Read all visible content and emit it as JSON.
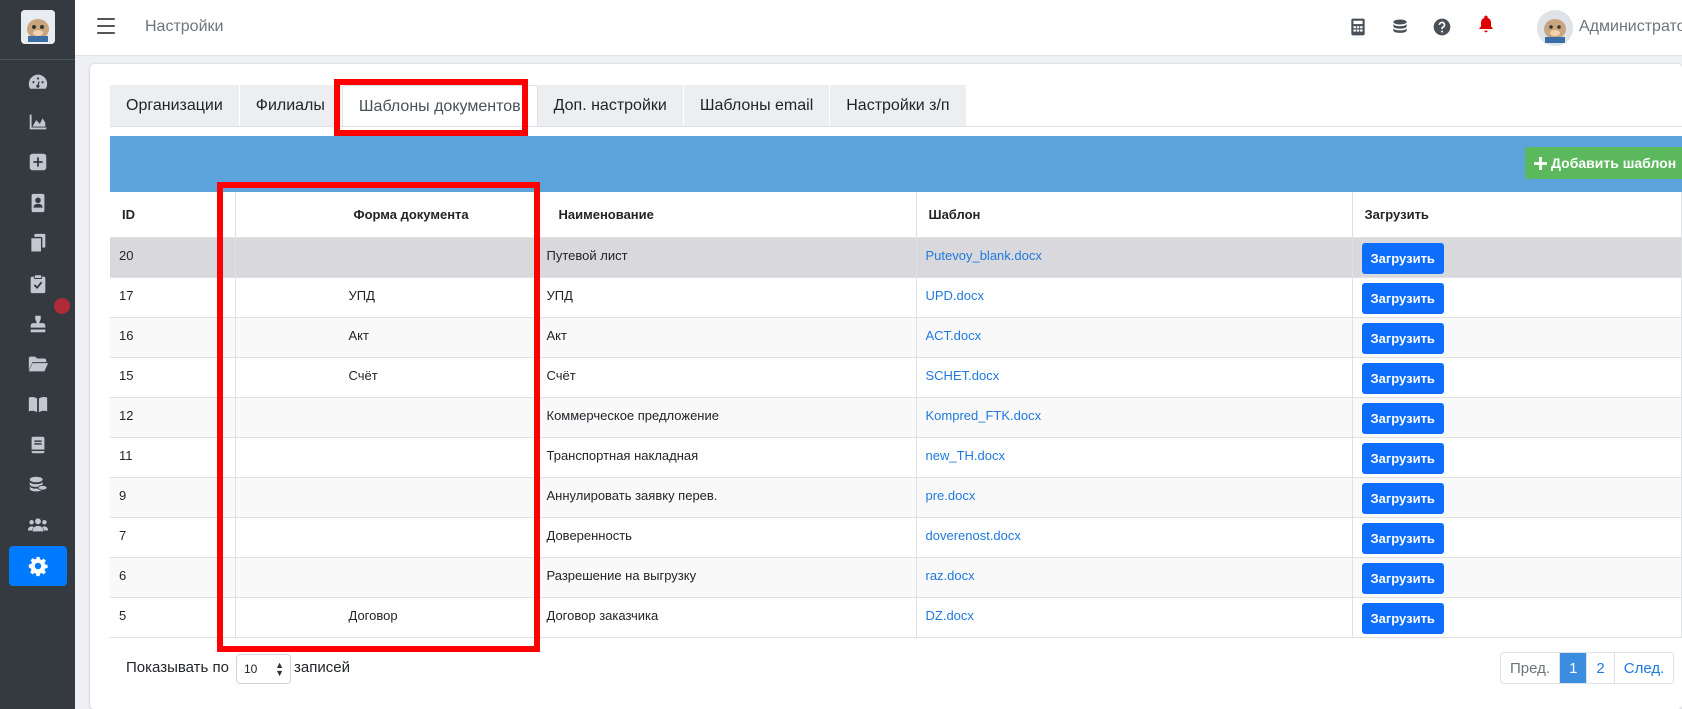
{
  "navbar": {
    "title": "Настройки",
    "user_name": "Администрато"
  },
  "sidebar": {
    "items": [
      {
        "icon": "tachometer-icon"
      },
      {
        "icon": "area-chart-icon"
      },
      {
        "icon": "plus-square-icon"
      },
      {
        "icon": "contact-card-icon"
      },
      {
        "icon": "copy-icon"
      },
      {
        "icon": "clipboard-check-icon"
      },
      {
        "icon": "stamp-icon"
      },
      {
        "icon": "folder-open-icon"
      },
      {
        "icon": "book-open-icon"
      },
      {
        "icon": "book-icon"
      },
      {
        "icon": "coins-icon"
      },
      {
        "icon": "users-icon"
      },
      {
        "icon": "gear-icon"
      }
    ],
    "active": "gear-icon"
  },
  "tabs": [
    {
      "label": "Организации"
    },
    {
      "label": "Филиалы"
    },
    {
      "label": "Шаблоны документов"
    },
    {
      "label": "Доп. настройки"
    },
    {
      "label": "Шаблоны email"
    },
    {
      "label": "Настройки з/п"
    }
  ],
  "active_tab": "Шаблоны документов",
  "add_button": {
    "label": "Добавить шаблон"
  },
  "table": {
    "headers": [
      "ID",
      "Форма документа",
      "Наименование",
      "Шаблон",
      "Загрузить"
    ],
    "rows": [
      {
        "id": "20",
        "form": "",
        "name": "Путевой лист",
        "file": "Putevoy_blank.docx",
        "action": "Загрузить"
      },
      {
        "id": "17",
        "form": "УПД",
        "name": "УПД",
        "file": "UPD.docx",
        "action": "Загрузить"
      },
      {
        "id": "16",
        "form": "Акт",
        "name": "Акт",
        "file": "ACT.docx",
        "action": "Загрузить"
      },
      {
        "id": "15",
        "form": "Счёт",
        "name": "Счёт",
        "file": "SCHET.docx",
        "action": "Загрузить"
      },
      {
        "id": "12",
        "form": "",
        "name": "Коммерческое предложение",
        "file": "Kompred_FTK.docx",
        "action": "Загрузить"
      },
      {
        "id": "11",
        "form": "",
        "name": "Транспортная накладная",
        "file": "new_TH.docx",
        "action": "Загрузить"
      },
      {
        "id": "9",
        "form": "",
        "name": "Аннулировать заявку перев.",
        "file": "pre.docx",
        "action": "Загрузить"
      },
      {
        "id": "7",
        "form": "",
        "name": "Доверенность",
        "file": "doverenost.docx",
        "action": "Загрузить"
      },
      {
        "id": "6",
        "form": "",
        "name": "Разрешение на выгрузку",
        "file": "raz.docx",
        "action": "Загрузить"
      },
      {
        "id": "5",
        "form": "Договор",
        "name": "Договор заказчика",
        "file": "DZ.docx",
        "action": "Загрузить"
      }
    ]
  },
  "footer": {
    "show_label": "Показывать по",
    "page_size": "10",
    "records_label": "записей",
    "pagination": {
      "prev": "Пред.",
      "pages": [
        "1",
        "2"
      ],
      "current": "1",
      "next": "След."
    }
  },
  "colors": {
    "sidebar_bg": "#343a40",
    "accent": "#007bff",
    "header_bar": "#5ba4dc",
    "add_button": "#5cb85c",
    "highlight": "#ff0000"
  }
}
